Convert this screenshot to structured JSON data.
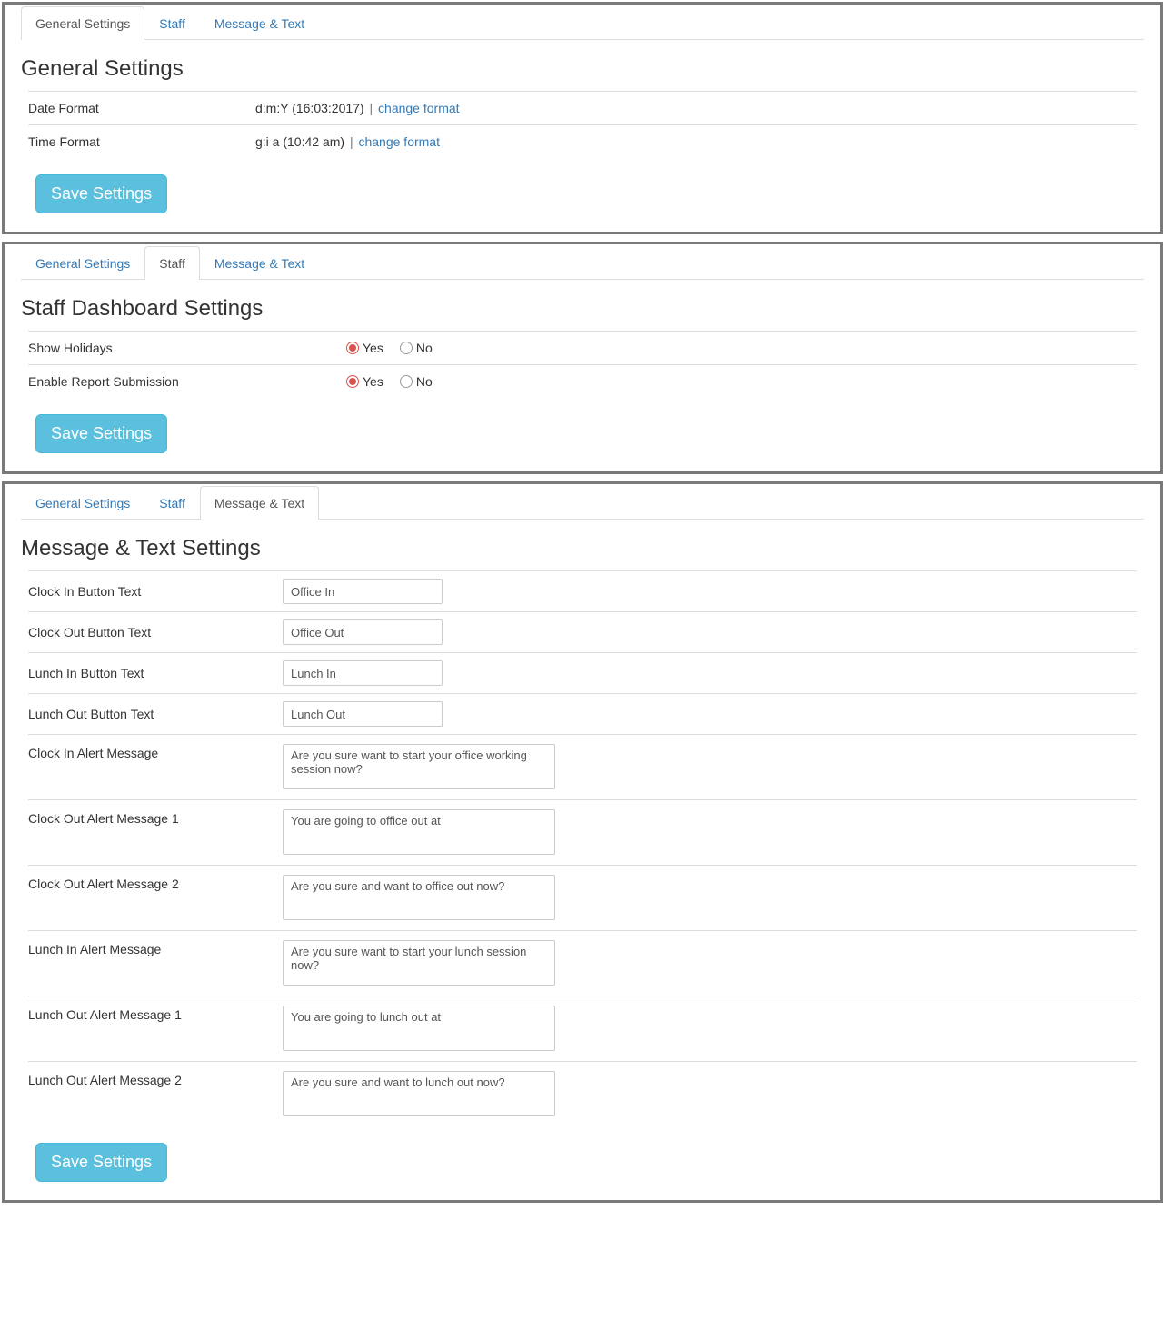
{
  "common": {
    "tab_general": "General Settings",
    "tab_staff": "Staff",
    "tab_message": "Message & Text",
    "save_button": "Save Settings",
    "yes": "Yes",
    "no": "No"
  },
  "panel1": {
    "heading": "General Settings",
    "date_format_label": "Date Format",
    "date_format_value": "d:m:Y (16:03:2017)",
    "date_format_change": "change format",
    "time_format_label": "Time Format",
    "time_format_value": "g:i a (10:42 am)",
    "time_format_change": "change format",
    "separator": "|"
  },
  "panel2": {
    "heading": "Staff Dashboard Settings",
    "show_holidays_label": "Show Holidays",
    "enable_report_label": "Enable Report Submission"
  },
  "panel3": {
    "heading": "Message & Text Settings",
    "clock_in_btn_label": "Clock In Button Text",
    "clock_in_btn_value": "Office In",
    "clock_out_btn_label": "Clock Out Button Text",
    "clock_out_btn_value": "Office Out",
    "lunch_in_btn_label": "Lunch In Button Text",
    "lunch_in_btn_value": "Lunch In",
    "lunch_out_btn_label": "Lunch Out Button Text",
    "lunch_out_btn_value": "Lunch Out",
    "clock_in_alert_label": "Clock In Alert Message",
    "clock_in_alert_value": "Are you sure want to start your office working session now?",
    "clock_out_alert1_label": "Clock Out Alert Message 1",
    "clock_out_alert1_value": "You are going to office out at",
    "clock_out_alert2_label": "Clock Out Alert Message 2",
    "clock_out_alert2_value": "Are you sure and want to office out now?",
    "lunch_in_alert_label": "Lunch In Alert Message",
    "lunch_in_alert_value": "Are you sure want to start your lunch session now?",
    "lunch_out_alert1_label": "Lunch Out Alert Message 1",
    "lunch_out_alert1_value": "You are going to lunch out at",
    "lunch_out_alert2_label": "Lunch Out Alert Message 2",
    "lunch_out_alert2_value": "Are you sure and want to lunch out now?"
  }
}
